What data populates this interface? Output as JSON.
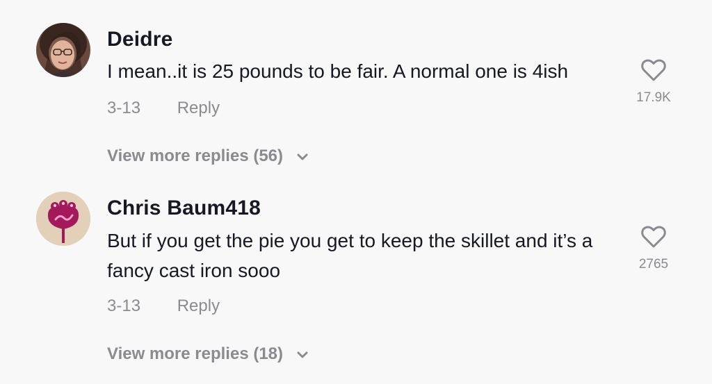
{
  "comments": [
    {
      "username": "Deidre",
      "text": "I mean..it is 25 pounds to be fair. A normal one is 4ish",
      "date": "3-13",
      "reply_label": "Reply",
      "likes": "17.9K",
      "view_more": "View more replies (56)",
      "avatar_icon": "avatar-photo"
    },
    {
      "username": "Chris Baum418",
      "text": "But if you get the pie you get to keep the skillet and it’s a fancy cast iron sooo",
      "date": "3-13",
      "reply_label": "Reply",
      "likes": "2765",
      "view_more": "View more replies (18)",
      "avatar_icon": "avatar-flower"
    }
  ],
  "colors": {
    "background": "#f8f8f8",
    "primary_text": "#161823",
    "secondary_text": "#8a8b91",
    "avatar2_bg": "#e2d0b9",
    "avatar2_accent": "#a3195b"
  }
}
